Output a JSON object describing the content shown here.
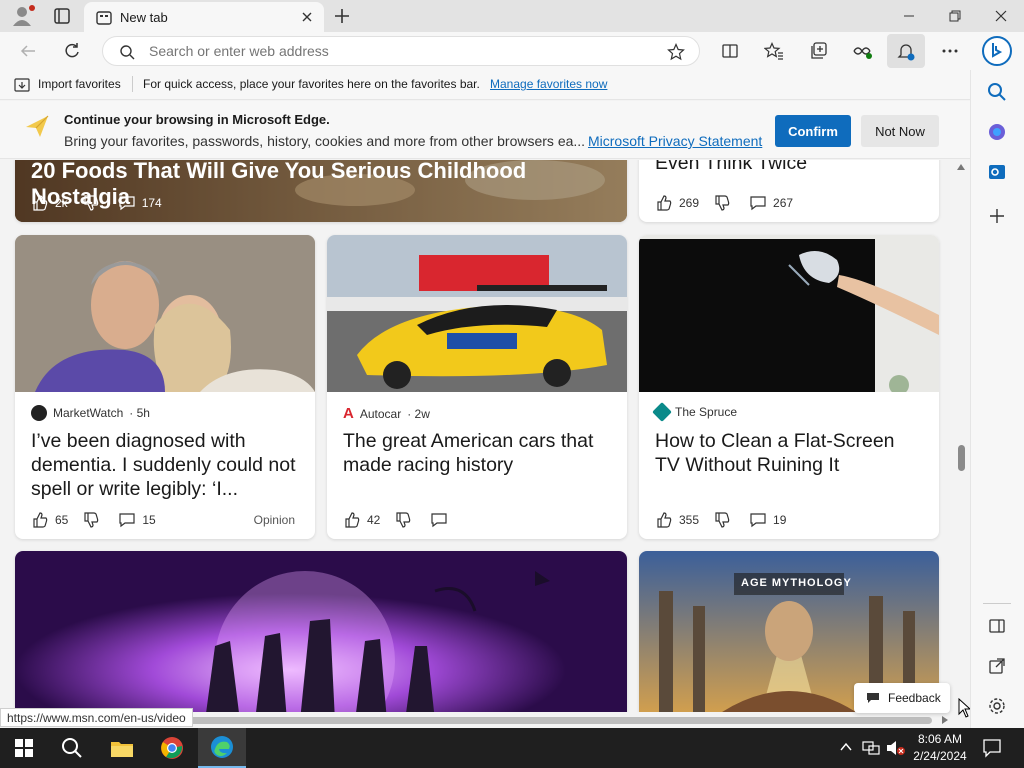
{
  "tab": {
    "title": "New tab"
  },
  "address": {
    "placeholder": "Search or enter web address"
  },
  "favorites_bar": {
    "import_label": "Import favorites",
    "hint": "For quick access, place your favorites here on the favorites bar.",
    "manage_link": "Manage favorites now"
  },
  "promo": {
    "title": "Continue your browsing in Microsoft Edge.",
    "body": "Bring your favorites, passwords, history, cookies and more from other browsers ea...",
    "privacy_link": "Microsoft Privacy Statement",
    "confirm_label": "Confirm",
    "not_now_label": "Not Now"
  },
  "top_cards": [
    {
      "headline": "20 Foods That Will Give You Serious Childhood Nostalgia",
      "likes": "2k",
      "comments": "174"
    },
    {
      "headline": "Even Think Twice'",
      "likes": "269",
      "comments": "267"
    }
  ],
  "cards": [
    {
      "source": "MarketWatch",
      "age": "· 5h",
      "headline": "I’ve been diagnosed with dementia. I suddenly could not spell or write legibly: ‘I...",
      "likes": "65",
      "comments": "15",
      "tag": "Opinion"
    },
    {
      "source": "Autocar",
      "age": "· 2w",
      "headline": "The great American cars that made racing history",
      "likes": "42",
      "comments": ""
    },
    {
      "source": "The Spruce",
      "age": "",
      "headline": "How to Clean a Flat-Screen TV Without Ruining It",
      "likes": "355",
      "comments": "19"
    }
  ],
  "bottom_cards": [
    {
      "image": "fantasy-heroes-purple"
    },
    {
      "image": "age-of-mythology-art",
      "logo_text": "AGE MYTHOLOGY"
    }
  ],
  "status_url": "https://www.msn.com/en-us/video",
  "feedback_label": "Feedback",
  "taskbar": {
    "time": "8:06 AM",
    "date": "2/24/2024"
  },
  "colors": {
    "accent": "#0f6cbd",
    "tabstrip": "#e3e3e3",
    "taskbar": "#1f1f1f"
  }
}
